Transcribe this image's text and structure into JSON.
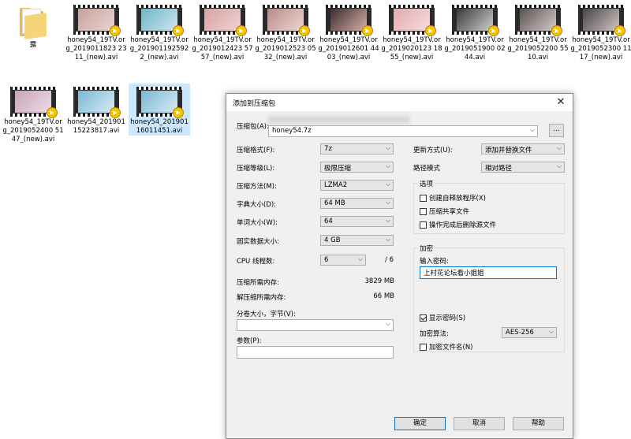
{
  "desktop": {
    "files": [
      {
        "type": "folder",
        "name": "露",
        "colors": []
      },
      {
        "type": "video",
        "name": "honey54_19TV.org_2019011823 2311_(new).avi",
        "colors": [
          "#c9a09a",
          "#e8d6d3"
        ]
      },
      {
        "type": "video",
        "name": "honey54_19TV.org_2019011925922_(new).avi",
        "colors": [
          "#6bb6c6",
          "#cfe7ee"
        ]
      },
      {
        "type": "video",
        "name": "honey54_19TV.org_2019012423 5757_(new).avi",
        "colors": [
          "#d7a3a3",
          "#f0d2d2"
        ]
      },
      {
        "type": "video",
        "name": "honey54_19TV.org_2019012523 0532_(new).avi",
        "colors": [
          "#b98a86",
          "#ecd9d6"
        ]
      },
      {
        "type": "video",
        "name": "honey54_19TV.org_2019012601 4403_(new).avi",
        "colors": [
          "#3d2b2d",
          "#d6b0aa"
        ]
      },
      {
        "type": "video",
        "name": "honey54_19TV.org_2019020123 1855_(new).avi",
        "colors": [
          "#e4aab0",
          "#f5dcdf"
        ]
      },
      {
        "type": "video",
        "name": "honey54_19TV.org_2019051900 0244.avi",
        "colors": [
          "#3a3a3a",
          "#cfcfcf"
        ]
      },
      {
        "type": "video",
        "name": "honey54_19TV.org_2019052200 5510.avi",
        "colors": [
          "#5a5050",
          "#d6cccc"
        ]
      },
      {
        "type": "video",
        "name": "honey54_19TV.org_2019052300 1117_(new).avi",
        "colors": [
          "#4a4444",
          "#d0c6c6"
        ]
      },
      {
        "type": "video",
        "name": "honey54_19TV.org_2019052400 5147_(new).avi",
        "colors": [
          "#c7a3b8",
          "#efdde7"
        ]
      },
      {
        "type": "video",
        "name": "honey54_20190115223817.avi",
        "colors": [
          "#7ab7d4",
          "#d7ecf5"
        ]
      },
      {
        "type": "video",
        "name": "honey54_20190116011451.avi",
        "colors": [
          "#7ab7d4",
          "#d7ecf5"
        ],
        "selected": true
      }
    ],
    "badge_text": "Player"
  },
  "dialog": {
    "title": "添加到压缩包",
    "close_glyph": "✕",
    "archive_label": "压缩包(A):",
    "archive_value": "honey54.7z",
    "browse_label": "...",
    "left_rows": [
      {
        "label": "压缩格式(F):",
        "value": "7z"
      },
      {
        "label": "压缩等级(L):",
        "value": "极限压缩"
      },
      {
        "label": "压缩方法(M):",
        "value": "LZMA2"
      },
      {
        "label": "字典大小(D):",
        "value": "64 MB"
      },
      {
        "label": "单词大小(W):",
        "value": "64"
      },
      {
        "label": "固实数据大小:",
        "value": "4 GB"
      }
    ],
    "cpu_label": "CPU 线程数:",
    "cpu_value": "6",
    "cpu_total": "/ 6",
    "mem_compress_label": "压缩所需内存:",
    "mem_compress_value": "3829 MB",
    "mem_decompress_label": "解压缩所需内存:",
    "mem_decompress_value": "66 MB",
    "split_label": "分卷大小，字节(V):",
    "split_value": "",
    "params_label": "参数(P):",
    "params_value": "",
    "update_label": "更新方式(U):",
    "update_value": "添加并替换文件",
    "path_label": "路径模式",
    "path_value": "相对路径",
    "options_title": "选项",
    "options": [
      {
        "label": "创建自释放程序(X)",
        "checked": false
      },
      {
        "label": "压缩共享文件",
        "checked": false
      },
      {
        "label": "操作完成后删除源文件",
        "checked": false
      }
    ],
    "encrypt_title": "加密",
    "password_label": "输入密码:",
    "password_value": "上村花论坛看小姐姐",
    "show_password_label": "显示密码(S)",
    "show_password_checked": true,
    "enc_method_label": "加密算法:",
    "enc_method_value": "AES-256",
    "encrypt_names_label": "加密文件名(N)",
    "encrypt_names_checked": false,
    "ok_label": "确定",
    "cancel_label": "取消",
    "help_label": "帮助"
  }
}
